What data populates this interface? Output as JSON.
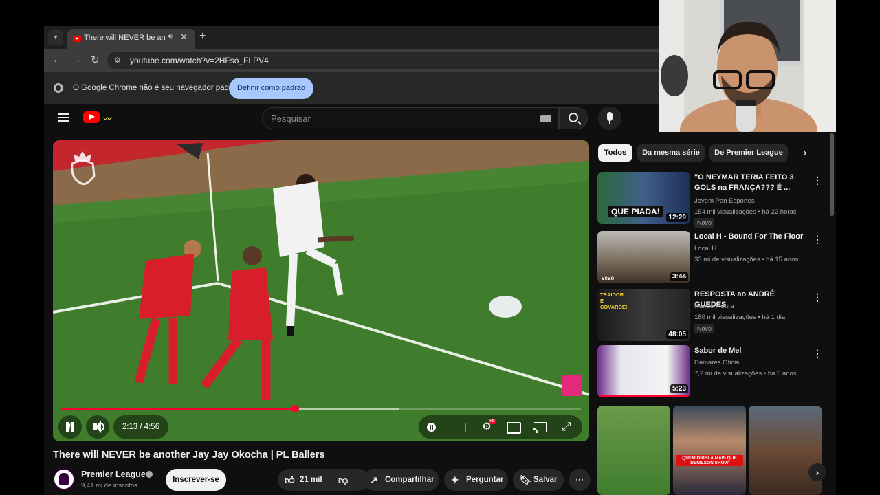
{
  "browser": {
    "tab_title": "There will NEVER be another",
    "url": "youtube.com/watch?v=2HFso_FLPV4",
    "infobar_text": "O Google Chrome não é seu navegador padrão",
    "infobar_button": "Definir como padrão"
  },
  "youtube": {
    "search_placeholder": "Pesquisar"
  },
  "player": {
    "current_time": "2:13",
    "duration": "4:56",
    "time_display": "2:13 / 4:56",
    "played_fraction": 0.45,
    "buffered_fraction": 0.65,
    "hd_badge": "HD"
  },
  "video": {
    "title": "There will NEVER be another Jay Jay Okocha | PL Ballers",
    "channel": "Premier League",
    "subscribers": "9,41 mi de inscritos",
    "subscribe_label": "Inscrever-se",
    "likes": "21 mil",
    "share_label": "Compartilhar",
    "ask_label": "Perguntar",
    "save_label": "Salvar"
  },
  "sidebar": {
    "chips": [
      "Todos",
      "Da mesma série",
      "De Premier League"
    ],
    "recommendations": [
      {
        "title": "\"O NEYMAR TERIA FEITO 3 GOLS na FRANÇA??? É ...",
        "channel": "Jovem Pan Esportes",
        "meta": "154 mil visualizações • há 22 horas",
        "badge": "Novo",
        "duration": "12:29",
        "thumb_text": "QUE PIADA!"
      },
      {
        "title": "Local H - Bound For The Floor",
        "channel": "Local H",
        "meta": "33 mi de visualizações • há 15 anos",
        "badge": "",
        "duration": "3:44",
        "thumb_text": "vevo"
      },
      {
        "title": "RESPOSTA ao ANDRÉ GUEDES",
        "channel": "Nando Moura",
        "meta": "180 mil visualizações • há 1 dia",
        "badge": "Novo",
        "duration": "48:05",
        "thumb_text": "TRAIDOR E COVARDE!"
      },
      {
        "title": "Sabor de Mel",
        "channel": "Damares Oficial",
        "meta": "7,2 mi de visualizações • há 5 anos",
        "badge": "",
        "duration": "5:23",
        "thumb_text": ""
      }
    ],
    "shorts_text": "QUEM DRIBLA MAIS QUE DENILSON SHOW"
  },
  "colors": {
    "accent_red": "#ff0033",
    "chrome_button": "#a8c7fa",
    "pitch_green": "#3f7d2d",
    "kit_red": "#d81e2a"
  }
}
